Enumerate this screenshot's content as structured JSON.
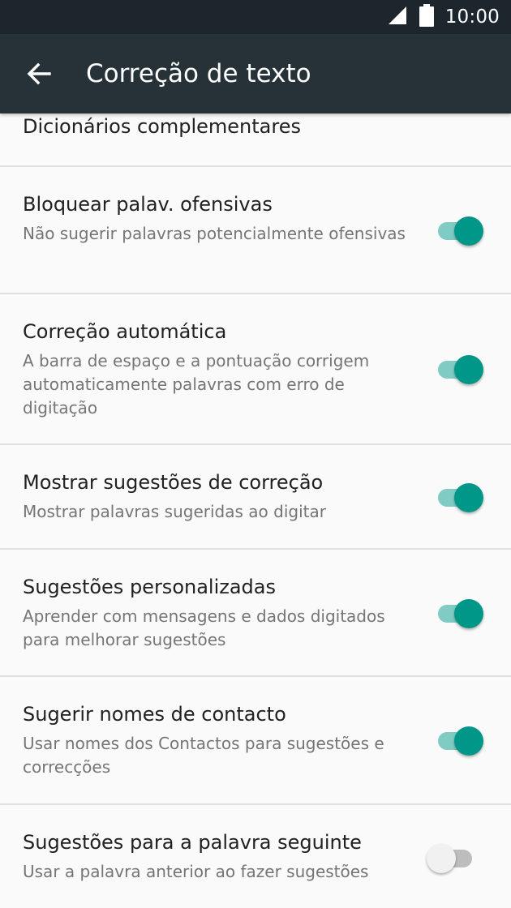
{
  "status_bar": {
    "time": "10:00",
    "icons": [
      "signal-icon",
      "battery-icon"
    ]
  },
  "app_bar": {
    "back_icon": "arrow-left-icon",
    "title": "Correção de texto"
  },
  "colors": {
    "app_bar": "#263238",
    "status_bar": "#1d262c",
    "accent": "#009688",
    "accent_track": "#80cbc4"
  },
  "settings": [
    {
      "title": "Dicionários complementares"
    },
    {
      "title": "Bloquear palav. ofensivas",
      "summary": "Não sugerir palavras potencialmente ofensivas",
      "enabled": true
    },
    {
      "title": "Correção automática",
      "summary": "A barra de espaço e a pontuação corrigem automaticamente palavras com erro de digitação",
      "enabled": true
    },
    {
      "title": "Mostrar sugestões de correção",
      "summary": "Mostrar palavras sugeridas ao digitar",
      "enabled": true
    },
    {
      "title": "Sugestões personalizadas",
      "summary": "Aprender com mensagens e dados digitados para melhorar sugestões",
      "enabled": true
    },
    {
      "title": "Sugerir nomes de contacto",
      "summary": "Usar nomes dos Contactos para sugestões e correcções",
      "enabled": true
    },
    {
      "title": "Sugestões para a palavra seguinte",
      "summary": "Usar a palavra anterior ao fazer sugestões",
      "enabled": false
    }
  ]
}
